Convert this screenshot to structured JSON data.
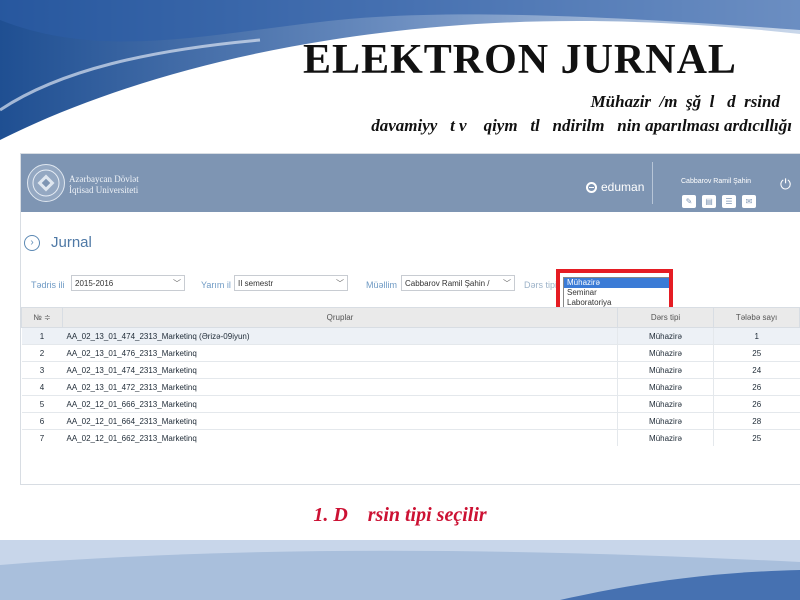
{
  "slide": {
    "title": "ELEKTRON JURNAL",
    "subtitle_line1": "Mühazir  /m  şğ  l   d  rsind",
    "subtitle_line2": "davamiyy   t v    qiym   tl   ndirilm   nin aparılması ardıcıllığı",
    "caption": "1. D    rsin tipi seçilir",
    "caption_color": "#cc1133"
  },
  "app": {
    "university_line1": "Azərbaycan Dövlət",
    "university_line2": "İqtisad Universiteti",
    "brand": "eduman",
    "user_name": "Cabbarov Ramil Şahin",
    "header_color": "#7e95b3",
    "header_icons": [
      "edit-icon",
      "archive-icon",
      "list-icon",
      "mail-icon"
    ],
    "page_title": "Jurnal"
  },
  "filters": {
    "year_label": "Tədris ili",
    "year_value": "2015-2016",
    "semester_label": "Yarım il",
    "semester_value": "II semestr",
    "teacher_label": "Müəllim",
    "teacher_value": "Cabbarov Ramil Şahin /",
    "lesson_type_label": "Dərs tipi",
    "lesson_type_options": [
      "Mühazirə",
      "Seminar",
      "Laboratoriya"
    ],
    "lesson_type_selected": "Mühazirə"
  },
  "table": {
    "headers": [
      "№",
      "Qruplar",
      "Dərs tipi",
      "Tələbə sayı"
    ],
    "rows": [
      {
        "no": "1",
        "group": "AA_02_13_01_474_2313_Marketinq (Ərizə-09iyun)",
        "type": "Mühazirə",
        "count": "1"
      },
      {
        "no": "2",
        "group": "AA_02_13_01_476_2313_Marketinq",
        "type": "Mühazirə",
        "count": "25"
      },
      {
        "no": "3",
        "group": "AA_02_13_01_474_2313_Marketinq",
        "type": "Mühazirə",
        "count": "24"
      },
      {
        "no": "4",
        "group": "AA_02_13_01_472_2313_Marketinq",
        "type": "Mühazirə",
        "count": "26"
      },
      {
        "no": "5",
        "group": "AA_02_12_01_666_2313_Marketinq",
        "type": "Mühazirə",
        "count": "26"
      },
      {
        "no": "6",
        "group": "AA_02_12_01_664_2313_Marketinq",
        "type": "Mühazirə",
        "count": "28"
      },
      {
        "no": "7",
        "group": "AA_02_12_01_662_2313_Marketinq",
        "type": "Mühazirə",
        "count": "25"
      }
    ]
  },
  "highlight_color": "#e51c23"
}
